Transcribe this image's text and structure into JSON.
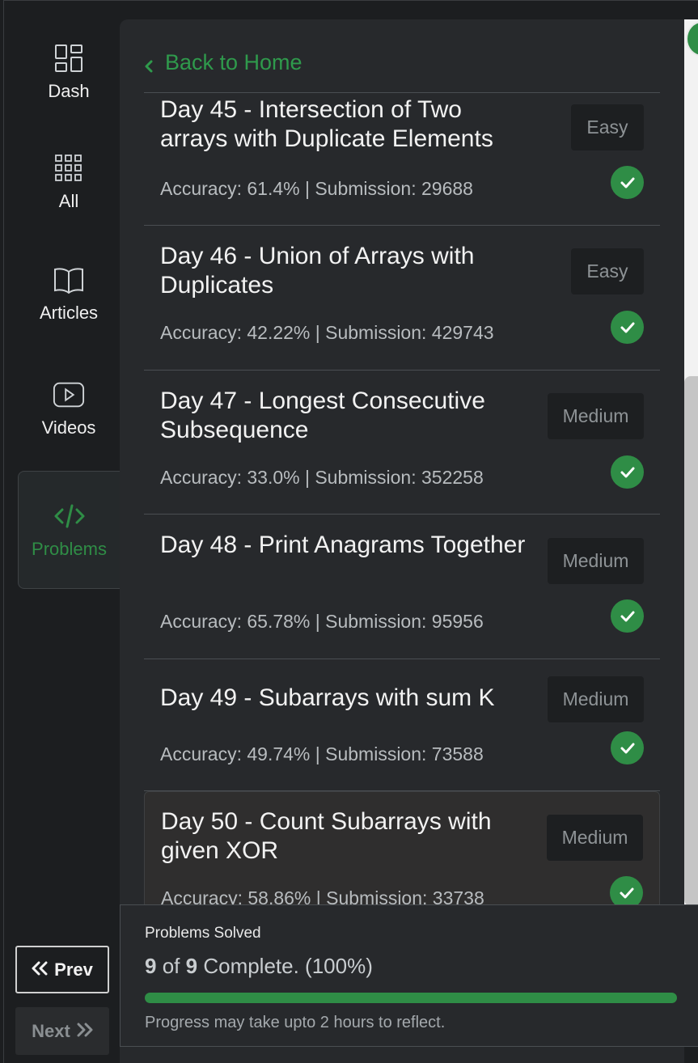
{
  "nav": {
    "items": [
      {
        "label": "Dash",
        "icon": "dashboard-icon"
      },
      {
        "label": "All",
        "icon": "grid-icon"
      },
      {
        "label": "Articles",
        "icon": "book-icon"
      },
      {
        "label": "Videos",
        "icon": "video-icon"
      },
      {
        "label": "Problems",
        "icon": "code-icon",
        "active": true
      }
    ],
    "prev_label": "Prev",
    "next_label": "Next"
  },
  "header": {
    "back_label": "Back to Home"
  },
  "problems": [
    {
      "title": "Day 45 - Intersection of Two arrays with Duplicate Elements",
      "meta": "Accuracy: 61.4% | Submission: 29688",
      "difficulty": "Easy",
      "solved": true
    },
    {
      "title": "Day 46 - Union of Arrays with Duplicates",
      "meta": "Accuracy: 42.22% | Submission: 429743",
      "difficulty": "Easy",
      "solved": true
    },
    {
      "title": "Day 47 - Longest Consecutive Subsequence",
      "meta": "Accuracy: 33.0% | Submission: 352258",
      "difficulty": "Medium",
      "solved": true
    },
    {
      "title": "Day 48 - Print Anagrams Together",
      "meta": "Accuracy: 65.78% | Submission: 95956",
      "difficulty": "Medium",
      "solved": true
    },
    {
      "title": "Day 49 - Subarrays with sum K",
      "meta": "Accuracy: 49.74% | Submission: 73588",
      "difficulty": "Medium",
      "solved": true
    },
    {
      "title": "Day 50 - Count Subarrays with given XOR",
      "meta": "Accuracy: 58.86% | Submission: 33738",
      "difficulty": "Medium",
      "solved": true
    }
  ],
  "progress": {
    "title": "Problems Solved",
    "solved": "9",
    "of": "of",
    "total": "9",
    "suffix": "Complete. (100%)",
    "fraction": 1.0,
    "note": "Progress may take upto 2 hours to reflect."
  },
  "colors": {
    "accent": "#2f8d46",
    "panel": "#27292c",
    "background": "#1c1e20"
  }
}
